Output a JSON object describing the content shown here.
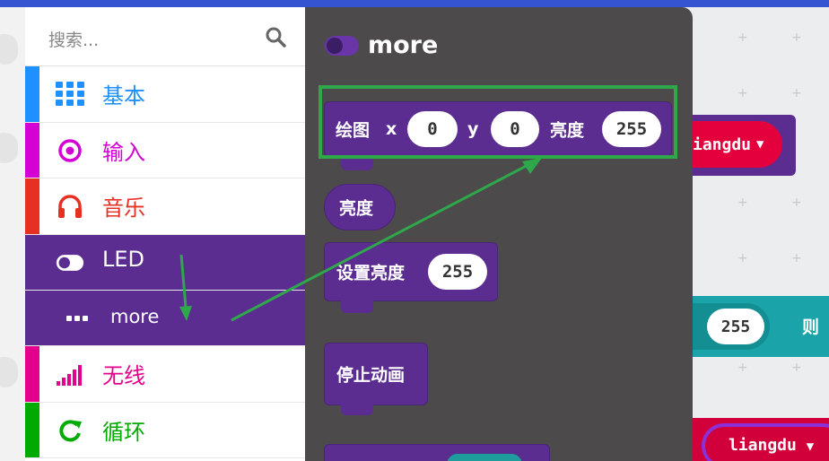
{
  "search": {
    "placeholder": "搜索..."
  },
  "categories": [
    {
      "label": "基本",
      "color": "#1e90ff",
      "icon": "grid-icon"
    },
    {
      "label": "输入",
      "color": "#d400d4",
      "icon": "radio-button-icon"
    },
    {
      "label": "音乐",
      "color": "#e63022",
      "icon": "headphones-icon"
    },
    {
      "label": "LED",
      "color": "#5c2d91",
      "icon": "toggle-icon"
    },
    {
      "label": "more",
      "color": "#5c2d91",
      "icon": "more-dots-icon"
    },
    {
      "label": "无线",
      "color": "#e3008c",
      "icon": "signal-bars-icon"
    },
    {
      "label": "循环",
      "color": "#00aa00",
      "icon": "refresh-icon"
    }
  ],
  "flyout": {
    "title": "more",
    "blocks": {
      "plot": {
        "label": "绘图",
        "x_label": "x",
        "x_value": "0",
        "y_label": "y",
        "y_value": "0",
        "brightness_label": "亮度",
        "brightness_value": "255"
      },
      "brightness": {
        "label": "亮度"
      },
      "set_brightness": {
        "label": "设置亮度",
        "value": "255"
      },
      "stop_animation": {
        "label": "停止动画"
      }
    }
  },
  "workspace": {
    "var_block_1": "iangdu",
    "value_pill": "255",
    "then_label": "则",
    "var_block_2": "liangdu"
  },
  "colors": {
    "led_purple": "#5c2d91",
    "highlight_green": "#2ea84a",
    "accent_blue": "#3454d1"
  }
}
